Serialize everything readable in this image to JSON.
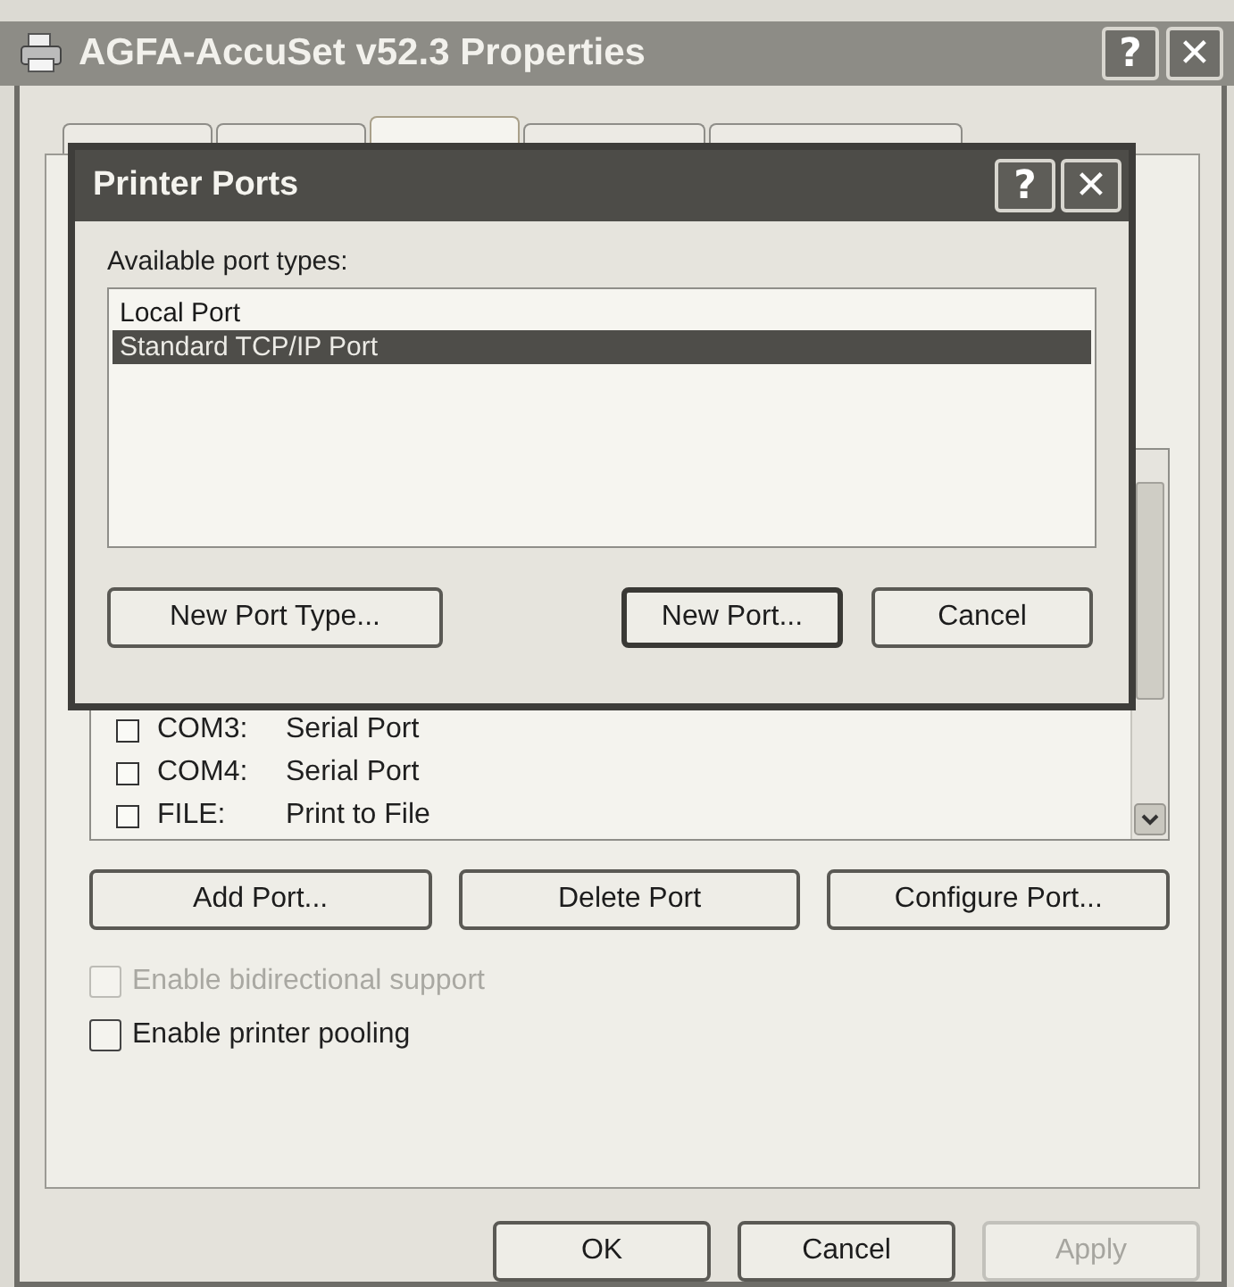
{
  "window": {
    "title": "AGFA-AccuSet v52.3 Properties",
    "title_buttons": [
      "?",
      "✕"
    ]
  },
  "tabs": [
    {
      "selected": false
    },
    {
      "selected": false
    },
    {
      "selected": true
    },
    {
      "selected": false
    },
    {
      "selected": false
    }
  ],
  "ports": [
    {
      "port": "COM3:",
      "description": "Serial Port",
      "checked": false
    },
    {
      "port": "COM4:",
      "description": "Serial Port",
      "checked": false
    },
    {
      "port": "FILE:",
      "description": "Print to File",
      "checked": false
    }
  ],
  "port_buttons": [
    "Add Port...",
    "Delete Port",
    "Configure Port..."
  ],
  "options": [
    {
      "label": "Enable bidirectional support",
      "checked": false,
      "disabled": true
    },
    {
      "label": "Enable printer pooling",
      "checked": false,
      "disabled": false
    }
  ],
  "buttons": [
    {
      "label": "OK",
      "disabled": false
    },
    {
      "label": "Cancel",
      "disabled": false
    },
    {
      "label": "Apply",
      "disabled": true
    }
  ],
  "dialog": {
    "title": "Printer Ports",
    "title_buttons": [
      "?",
      "✕"
    ],
    "list_label": "Available port types:",
    "port_types": [
      {
        "label": "Local Port",
        "selected": false
      },
      {
        "label": "Standard TCP/IP Port",
        "selected": true
      }
    ],
    "buttons": [
      {
        "label": "New Port Type...",
        "default": false
      },
      {
        "label": "New Port...",
        "default": true
      },
      {
        "label": "Cancel",
        "default": false
      }
    ]
  }
}
